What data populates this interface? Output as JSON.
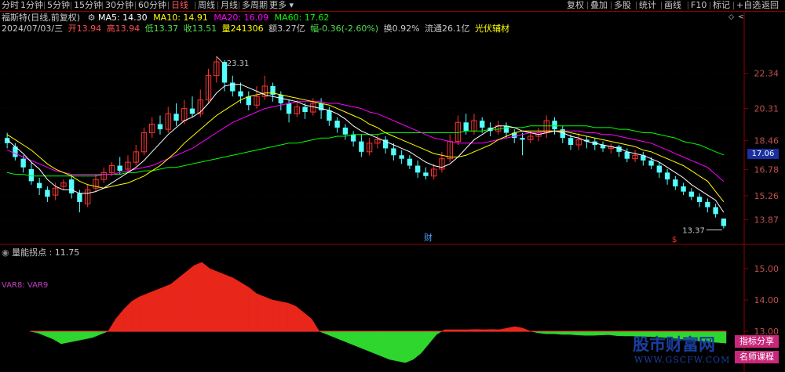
{
  "toolbar": {
    "periods": [
      "分时",
      "1分钟",
      "5分钟",
      "15分钟",
      "30分钟",
      "60分钟",
      "日线",
      "周线",
      "月线",
      "多周期",
      "更多"
    ],
    "active": "日线",
    "more_arrow": "▾",
    "right_buttons": [
      "复权",
      "叠加",
      "多股",
      "统计",
      "画线",
      "F10",
      "标记",
      "+自选",
      "返回"
    ]
  },
  "info": {
    "stock_name": "福斯特(日线,前复权)",
    "ma5_label": "MA5: 14.30",
    "ma10_label": "MA10: 14.91",
    "ma20_label": "MA20: 16.09",
    "ma60_label": "MA60: 17.62",
    "date": "2024/07/03/三",
    "open": "开13.94",
    "high": "高13.94",
    "low": "低13.37",
    "close": "收13.51",
    "volume": "量241306",
    "amount": "额3.27亿",
    "change": "幅-0.36(-2.60%)",
    "turnover": "换0.92%",
    "float": "流通26.1亿",
    "sector": "光伏辅材"
  },
  "price_axis": [
    "22.34",
    "20.31",
    "18.46",
    "16.78",
    "15.26",
    "13.87"
  ],
  "current_price": "17.06",
  "annotations": {
    "high_mark": "23.31",
    "low_mark": "13.37",
    "cai": "财",
    "s_mark": "$"
  },
  "indicator": {
    "title": "量能拐点 : 11.75",
    "legend": "VAR8: VAR9",
    "axis": [
      "15.00",
      "14.00",
      "13.00"
    ]
  },
  "watermark": {
    "site": "股市财富网",
    "url": "WWW.GSCFW.COM",
    "tag1": "指标分享",
    "tag2": "名师课程"
  },
  "colors": {
    "up": "#ff3232",
    "down": "#54ffff",
    "ma5": "#ffffff",
    "ma10": "#ffff00",
    "ma20": "#ff00ff",
    "ma60": "#00ff00",
    "ind_red": "#e8261a",
    "ind_green": "#2ed62e"
  },
  "chart_data": {
    "type": "candlestick",
    "candles": [
      [
        18.6,
        18.3,
        18.9,
        18.0
      ],
      [
        18.1,
        17.5,
        18.3,
        17.3
      ],
      [
        17.4,
        16.9,
        17.6,
        16.6
      ],
      [
        16.8,
        16.1,
        17.2,
        15.9
      ],
      [
        16.0,
        15.7,
        16.3,
        15.3
      ],
      [
        15.6,
        15.2,
        15.8,
        14.9
      ],
      [
        15.3,
        15.7,
        16.0,
        15.0
      ],
      [
        15.8,
        16.0,
        16.2,
        15.6
      ],
      [
        16.2,
        15.4,
        16.5,
        15.1
      ],
      [
        15.4,
        14.9,
        15.6,
        14.3
      ],
      [
        14.8,
        15.6,
        15.9,
        14.6
      ],
      [
        15.7,
        16.2,
        16.5,
        15.5
      ],
      [
        16.2,
        16.6,
        16.9,
        16.0
      ],
      [
        16.6,
        17.0,
        17.2,
        16.4
      ],
      [
        17.0,
        16.7,
        17.5,
        16.5
      ],
      [
        16.8,
        17.2,
        17.6,
        16.6
      ],
      [
        17.2,
        17.8,
        18.2,
        17.0
      ],
      [
        17.8,
        18.9,
        19.2,
        17.6
      ],
      [
        18.9,
        19.4,
        19.8,
        18.6
      ],
      [
        19.4,
        19.1,
        19.9,
        18.8
      ],
      [
        19.1,
        20.0,
        20.4,
        18.9
      ],
      [
        20.0,
        19.6,
        20.6,
        19.3
      ],
      [
        19.6,
        20.3,
        20.8,
        19.4
      ],
      [
        20.3,
        20.0,
        21.0,
        19.8
      ],
      [
        20.0,
        20.8,
        21.4,
        19.8
      ],
      [
        20.8,
        22.2,
        22.6,
        20.6
      ],
      [
        22.2,
        23.0,
        23.31,
        21.8
      ],
      [
        23.0,
        21.8,
        23.1,
        21.3
      ],
      [
        21.8,
        21.3,
        22.2,
        21.0
      ],
      [
        21.3,
        21.0,
        21.8,
        20.6
      ],
      [
        21.0,
        20.5,
        21.3,
        20.2
      ],
      [
        20.5,
        21.0,
        21.6,
        20.3
      ],
      [
        21.0,
        21.6,
        22.2,
        20.8
      ],
      [
        21.6,
        21.1,
        21.8,
        20.7
      ],
      [
        21.1,
        20.6,
        21.3,
        20.2
      ],
      [
        20.6,
        20.0,
        20.8,
        19.5
      ],
      [
        20.0,
        20.4,
        20.8,
        19.8
      ],
      [
        20.4,
        20.1,
        20.6,
        19.7
      ],
      [
        20.1,
        20.6,
        20.9,
        19.9
      ],
      [
        20.6,
        20.2,
        20.9,
        19.7
      ],
      [
        20.2,
        19.6,
        20.4,
        19.3
      ],
      [
        19.6,
        19.2,
        19.8,
        18.9
      ],
      [
        19.2,
        18.8,
        19.4,
        18.5
      ],
      [
        18.8,
        18.4,
        19.0,
        18.1
      ],
      [
        18.4,
        17.8,
        18.8,
        17.5
      ],
      [
        17.8,
        18.3,
        18.6,
        17.6
      ],
      [
        18.3,
        18.5,
        18.8,
        18.0
      ],
      [
        18.5,
        18.0,
        18.7,
        17.7
      ],
      [
        18.0,
        17.6,
        18.3,
        17.3
      ],
      [
        17.6,
        17.4,
        17.9,
        17.1
      ],
      [
        17.4,
        17.0,
        17.6,
        16.8
      ],
      [
        17.0,
        16.6,
        17.3,
        16.3
      ],
      [
        16.6,
        16.4,
        16.9,
        16.2
      ],
      [
        16.4,
        16.8,
        17.1,
        16.2
      ],
      [
        16.8,
        17.4,
        17.8,
        16.6
      ],
      [
        17.4,
        18.4,
        18.8,
        17.2
      ],
      [
        18.4,
        19.5,
        19.9,
        18.2
      ],
      [
        19.5,
        19.0,
        20.0,
        18.8
      ],
      [
        19.0,
        19.6,
        20.0,
        18.8
      ],
      [
        19.6,
        19.2,
        19.8,
        18.9
      ],
      [
        19.2,
        19.0,
        19.5,
        18.7
      ],
      [
        19.0,
        19.3,
        19.6,
        18.8
      ],
      [
        19.3,
        18.9,
        19.5,
        18.6
      ],
      [
        18.9,
        18.6,
        19.1,
        18.3
      ],
      [
        18.6,
        18.5,
        18.9,
        17.6
      ],
      [
        18.5,
        18.7,
        19.0,
        18.3
      ],
      [
        18.7,
        18.9,
        19.2,
        18.4
      ],
      [
        18.9,
        19.6,
        19.9,
        18.6
      ],
      [
        19.6,
        19.1,
        19.8,
        18.8
      ],
      [
        19.1,
        18.6,
        19.3,
        18.3
      ],
      [
        18.6,
        18.2,
        18.8,
        17.9
      ],
      [
        18.2,
        18.5,
        18.9,
        17.9
      ],
      [
        18.5,
        18.4,
        18.7,
        18.0
      ],
      [
        18.4,
        18.2,
        18.6,
        17.9
      ],
      [
        18.2,
        18.0,
        18.4,
        17.8
      ],
      [
        18.0,
        18.1,
        18.3,
        17.7
      ],
      [
        18.1,
        17.8,
        18.2,
        17.5
      ],
      [
        17.8,
        17.4,
        18.0,
        17.2
      ],
      [
        17.4,
        17.6,
        17.9,
        17.2
      ],
      [
        17.6,
        17.3,
        17.8,
        17.0
      ],
      [
        17.3,
        17.0,
        17.5,
        16.8
      ],
      [
        17.0,
        16.6,
        17.2,
        16.3
      ],
      [
        16.6,
        16.2,
        16.8,
        15.9
      ],
      [
        16.2,
        15.8,
        16.4,
        15.6
      ],
      [
        15.8,
        15.5,
        16.0,
        15.3
      ],
      [
        15.5,
        15.2,
        15.7,
        15.0
      ],
      [
        15.2,
        14.9,
        15.4,
        14.6
      ],
      [
        14.9,
        14.6,
        15.1,
        14.3
      ],
      [
        14.6,
        14.2,
        14.8,
        14.0
      ],
      [
        13.94,
        13.51,
        13.94,
        13.37
      ]
    ],
    "ma5": [
      18.5,
      18.1,
      17.7,
      17.2,
      16.8,
      16.2,
      15.8,
      15.6,
      15.6,
      15.4,
      15.4,
      15.5,
      15.7,
      16.0,
      16.3,
      16.6,
      16.9,
      17.3,
      17.8,
      18.3,
      18.8,
      19.2,
      19.6,
      19.8,
      20.1,
      20.6,
      21.2,
      21.6,
      21.7,
      21.7,
      21.5,
      21.3,
      21.1,
      21.0,
      20.9,
      20.8,
      20.7,
      20.5,
      20.4,
      20.3,
      20.2,
      20.0,
      19.7,
      19.3,
      19.0,
      18.8,
      18.6,
      18.4,
      18.2,
      18.0,
      17.8,
      17.5,
      17.2,
      17.0,
      16.9,
      17.1,
      17.5,
      18.0,
      18.5,
      18.8,
      19.1,
      19.3,
      19.3,
      19.2,
      19.0,
      18.9,
      18.8,
      18.9,
      19.0,
      18.9,
      18.7,
      18.6,
      18.4,
      18.3,
      18.2,
      18.1,
      18.0,
      17.8,
      17.7,
      17.6,
      17.4,
      17.2,
      16.9,
      16.6,
      16.3,
      15.9,
      15.6,
      15.3,
      15.0,
      14.3
    ],
    "ma10": [
      18.8,
      18.5,
      18.2,
      17.9,
      17.5,
      17.1,
      16.8,
      16.6,
      16.4,
      16.1,
      15.9,
      15.8,
      15.7,
      15.8,
      15.9,
      16.0,
      16.2,
      16.4,
      16.7,
      17.0,
      17.4,
      17.8,
      18.3,
      18.7,
      19.1,
      19.5,
      19.9,
      20.2,
      20.5,
      20.8,
      21.0,
      21.1,
      21.2,
      21.2,
      21.1,
      21.0,
      20.9,
      20.8,
      20.7,
      20.6,
      20.5,
      20.3,
      20.1,
      19.9,
      19.7,
      19.4,
      19.2,
      18.9,
      18.7,
      18.5,
      18.3,
      18.1,
      17.9,
      17.7,
      17.6,
      17.5,
      17.5,
      17.6,
      17.8,
      18.0,
      18.2,
      18.5,
      18.7,
      18.9,
      19.0,
      19.0,
      19.0,
      19.0,
      19.0,
      19.0,
      18.9,
      18.8,
      18.7,
      18.6,
      18.5,
      18.4,
      18.3,
      18.2,
      18.1,
      17.9,
      17.8,
      17.6,
      17.4,
      17.2,
      17.0,
      16.7,
      16.4,
      16.1,
      15.5,
      14.91
    ],
    "ma20": [
      17.9,
      17.7,
      17.5,
      17.3,
      17.1,
      16.9,
      16.7,
      16.6,
      16.5,
      16.5,
      16.5,
      16.5,
      16.5,
      16.5,
      16.6,
      16.7,
      16.8,
      16.9,
      17.0,
      17.2,
      17.4,
      17.6,
      17.8,
      18.0,
      18.3,
      18.6,
      18.9,
      19.2,
      19.5,
      19.7,
      19.9,
      20.1,
      20.3,
      20.4,
      20.5,
      20.6,
      20.7,
      20.7,
      20.7,
      20.7,
      20.6,
      20.6,
      20.5,
      20.4,
      20.3,
      20.1,
      20.0,
      19.8,
      19.6,
      19.4,
      19.2,
      19.0,
      18.8,
      18.6,
      18.5,
      18.4,
      18.3,
      18.3,
      18.3,
      18.3,
      18.4,
      18.5,
      18.6,
      18.7,
      18.8,
      18.9,
      18.9,
      19.0,
      19.0,
      19.0,
      19.0,
      19.0,
      18.9,
      18.9,
      18.8,
      18.8,
      18.7,
      18.6,
      18.5,
      18.4,
      18.3,
      18.1,
      17.9,
      17.7,
      17.5,
      17.3,
      17.1,
      16.9,
      16.5,
      16.09
    ],
    "ma60": [
      16.6,
      16.5,
      16.5,
      16.4,
      16.4,
      16.4,
      16.4,
      16.4,
      16.4,
      16.4,
      16.4,
      16.4,
      16.5,
      16.5,
      16.5,
      16.6,
      16.6,
      16.7,
      16.7,
      16.8,
      16.9,
      16.9,
      17.0,
      17.1,
      17.2,
      17.3,
      17.4,
      17.5,
      17.6,
      17.7,
      17.8,
      17.9,
      18.0,
      18.1,
      18.2,
      18.3,
      18.3,
      18.4,
      18.5,
      18.6,
      18.6,
      18.7,
      18.7,
      18.8,
      18.8,
      18.8,
      18.8,
      18.9,
      18.9,
      18.9,
      18.9,
      18.9,
      18.9,
      18.9,
      18.9,
      18.9,
      18.9,
      19.0,
      19.0,
      19.0,
      19.1,
      19.1,
      19.2,
      19.2,
      19.2,
      19.3,
      19.3,
      19.3,
      19.3,
      19.3,
      19.3,
      19.3,
      19.3,
      19.2,
      19.2,
      19.2,
      19.1,
      19.1,
      19.0,
      18.9,
      18.9,
      18.8,
      18.7,
      18.6,
      18.4,
      18.3,
      18.2,
      18.0,
      17.8,
      17.62
    ],
    "indicator": [
      13.0,
      12.95,
      12.85,
      12.75,
      12.6,
      12.65,
      12.7,
      12.75,
      12.8,
      12.9,
      13.0,
      13.4,
      13.7,
      13.95,
      14.1,
      14.2,
      14.3,
      14.4,
      14.5,
      14.7,
      14.9,
      15.1,
      15.2,
      15.0,
      14.9,
      14.8,
      14.7,
      14.55,
      14.4,
      14.2,
      14.1,
      14.0,
      13.95,
      13.9,
      13.8,
      13.6,
      13.4,
      13.0,
      12.9,
      12.8,
      12.7,
      12.6,
      12.5,
      12.4,
      12.3,
      12.2,
      12.1,
      12.05,
      12.0,
      12.1,
      12.3,
      12.6,
      12.9,
      13.05,
      13.05,
      13.05,
      13.05,
      13.06,
      13.05,
      13.06,
      13.05,
      13.1,
      13.15,
      13.1,
      13.0,
      12.95,
      12.92,
      12.92,
      12.9,
      12.9,
      12.88,
      12.87,
      12.87,
      12.88,
      12.89,
      12.86,
      12.85,
      12.85,
      12.84,
      12.83,
      12.82,
      12.8,
      12.78,
      12.76,
      12.72,
      12.7,
      12.68,
      12.66,
      12.64,
      12.62
    ],
    "ylim": [
      13.37,
      23.31
    ],
    "ind_ylim": [
      11.75,
      15.2
    ]
  }
}
